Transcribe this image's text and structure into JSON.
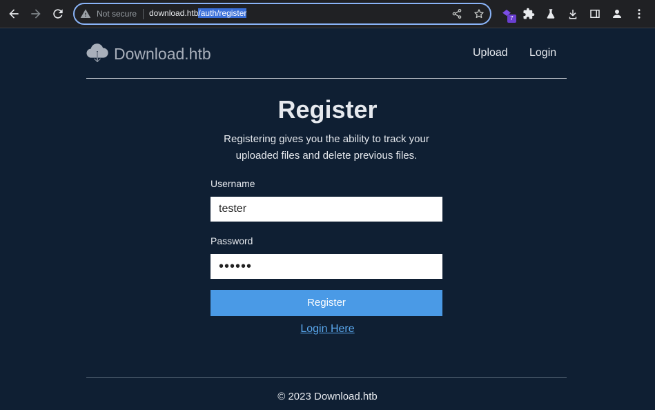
{
  "browser": {
    "security_label": "Not secure",
    "url_host": "download.htb",
    "url_path": "/auth/register",
    "extension_badge": "7"
  },
  "site": {
    "brand": "Download.htb",
    "nav": {
      "upload": "Upload",
      "login": "Login"
    }
  },
  "form": {
    "title": "Register",
    "subtitle": "Registering gives you the ability to track your uploaded files and delete previous files.",
    "username_label": "Username",
    "username_value": "tester",
    "password_label": "Password",
    "password_value": "••••••",
    "submit_label": "Register",
    "login_link": "Login Here"
  },
  "footer": {
    "text": "© 2023 Download.htb"
  },
  "colors": {
    "page_bg": "#0f1f33",
    "button": "#4a9ae6",
    "link": "#5aa8ee",
    "brand_text": "#a8afba"
  },
  "icons": [
    "back-icon",
    "forward-icon",
    "reload-icon",
    "warning-icon",
    "share-icon",
    "star-icon",
    "extension-icon",
    "puzzle-icon",
    "labs-icon",
    "download-icon",
    "side-panel-icon",
    "profile-icon",
    "menu-icon",
    "cloud-download-icon"
  ]
}
